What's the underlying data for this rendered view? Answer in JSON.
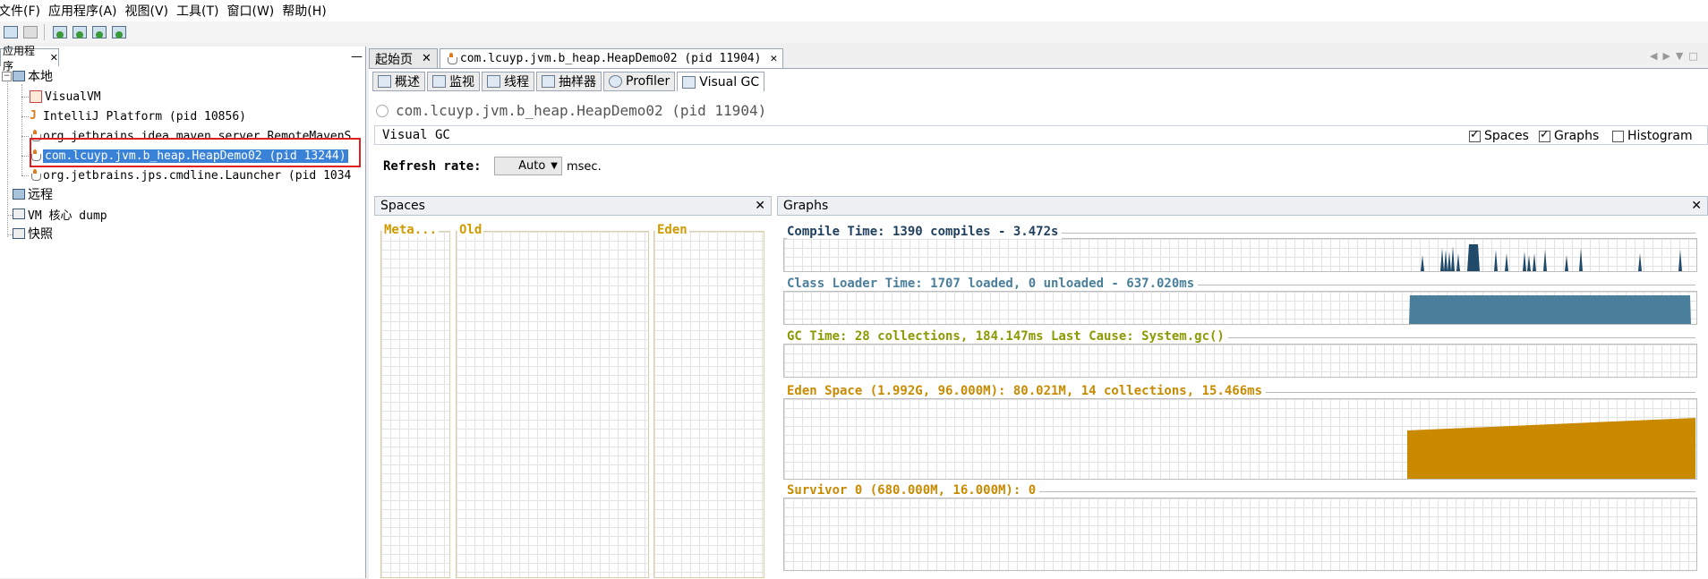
{
  "menu": [
    "文件(F)",
    "应用程序(A)",
    "视图(V)",
    "工具(T)",
    "窗口(W)",
    "帮助(H)"
  ],
  "left_panel": {
    "tab_label": "应用程序",
    "tree": {
      "local": "本地",
      "local_items": [
        "VisualVM",
        "IntelliJ Platform (pid 10856)",
        "org.jetbrains.idea.maven.server.RemoteMavenS",
        "com.lcuyp.jvm.b_heap.HeapDemo02 (pid 13244)",
        "org.jetbrains.jps.cmdline.Launcher (pid 1034"
      ],
      "remote": "远程",
      "vm_dump": "VM 核心 dump",
      "snapshot": "快照"
    }
  },
  "doc_tabs": [
    "起始页",
    "com.lcuyp.jvm.b_heap.HeapDemo02 (pid 11904)"
  ],
  "sub_tabs": [
    "概述",
    "监视",
    "线程",
    "抽样器",
    "Profiler",
    "Visual GC"
  ],
  "process_title": "com.lcuyp.jvm.b_heap.HeapDemo02 (pid 11904)",
  "visual_gc": {
    "label": "Visual GC",
    "options": [
      {
        "label": "Spaces",
        "checked": true
      },
      {
        "label": "Graphs",
        "checked": true
      },
      {
        "label": "Histogram",
        "checked": false
      }
    ],
    "refresh_label": "Refresh rate:",
    "refresh_value": "Auto",
    "refresh_unit": "msec."
  },
  "spaces_panel": {
    "title": "Spaces",
    "spaces": [
      "Meta...",
      "Old",
      "Eden"
    ]
  },
  "graphs_panel": {
    "title": "Graphs",
    "graphs": [
      {
        "title": "Compile Time: 1390 compiles - 3.472s",
        "color": "#1f3f5f"
      },
      {
        "title": "Class Loader Time: 1707 loaded, 0 unloaded - 637.020ms",
        "color": "#4a7f9c"
      },
      {
        "title": "GC Time: 28 collections, 184.147ms Last Cause: System.gc()",
        "color": "#8a9a00"
      },
      {
        "title": "Eden Space (1.992G, 96.000M): 80.021M, 14 collections, 15.466ms",
        "color": "#c98a00"
      },
      {
        "title": "Survivor 0 (680.000M, 16.000M): 0",
        "color": "#c98a00"
      }
    ]
  },
  "colors": {
    "compile": "#1f4a6a",
    "classloader": "#4a7f9c",
    "gc": "#8a9a00",
    "eden": "#c98a00",
    "selection": "#3a82d7",
    "highlight_box": "#e02020"
  }
}
